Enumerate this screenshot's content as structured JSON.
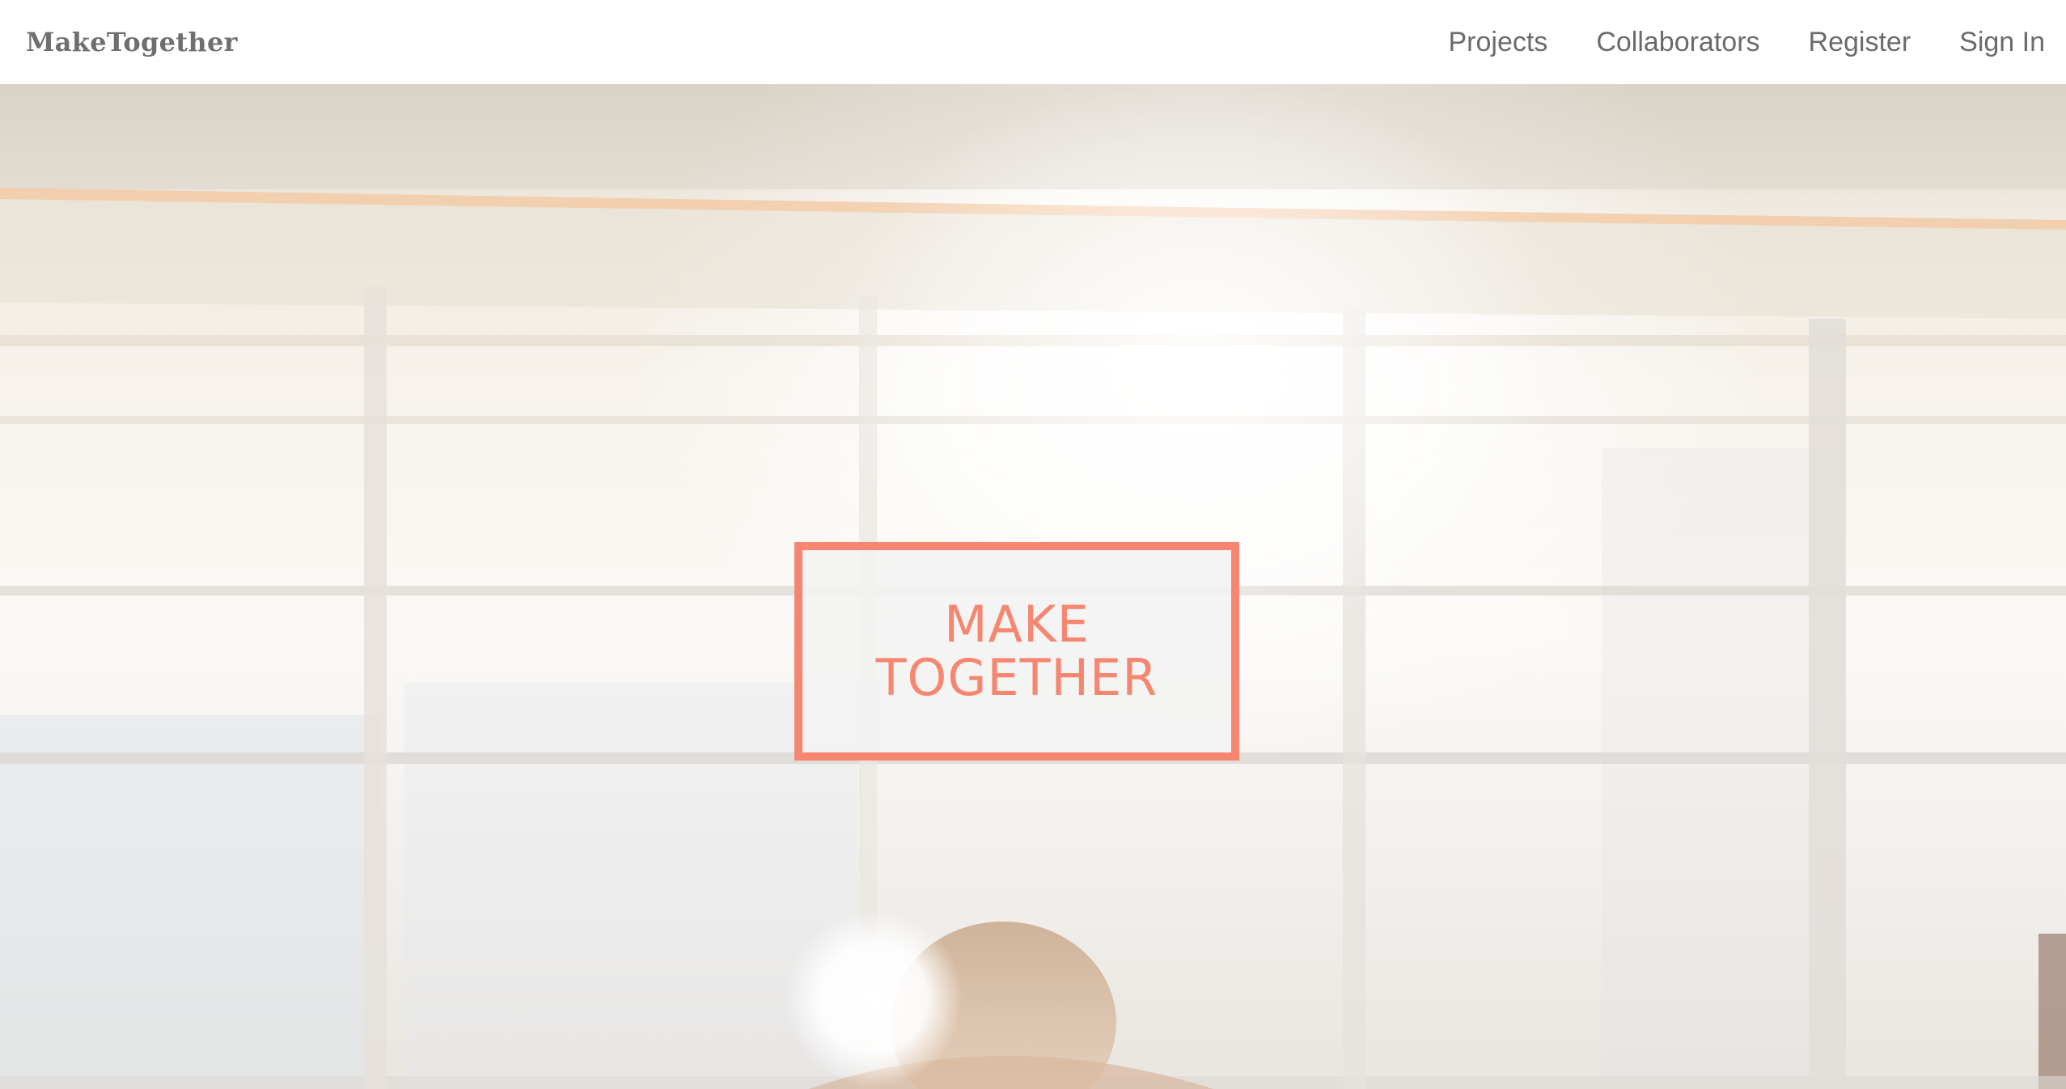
{
  "brand": {
    "name": "MakeTogether"
  },
  "nav": {
    "items": [
      {
        "label": "Projects"
      },
      {
        "label": "Collaborators"
      },
      {
        "label": "Register"
      },
      {
        "label": "Sign In"
      }
    ]
  },
  "hero": {
    "title_line1": "MAKE",
    "title_line2": "TOGETHER",
    "accent_color": "#f6866f"
  },
  "colors": {
    "navbar_bg": "#ffffff",
    "nav_text": "#6b6b6b",
    "brand_text": "#6f6f6f"
  }
}
